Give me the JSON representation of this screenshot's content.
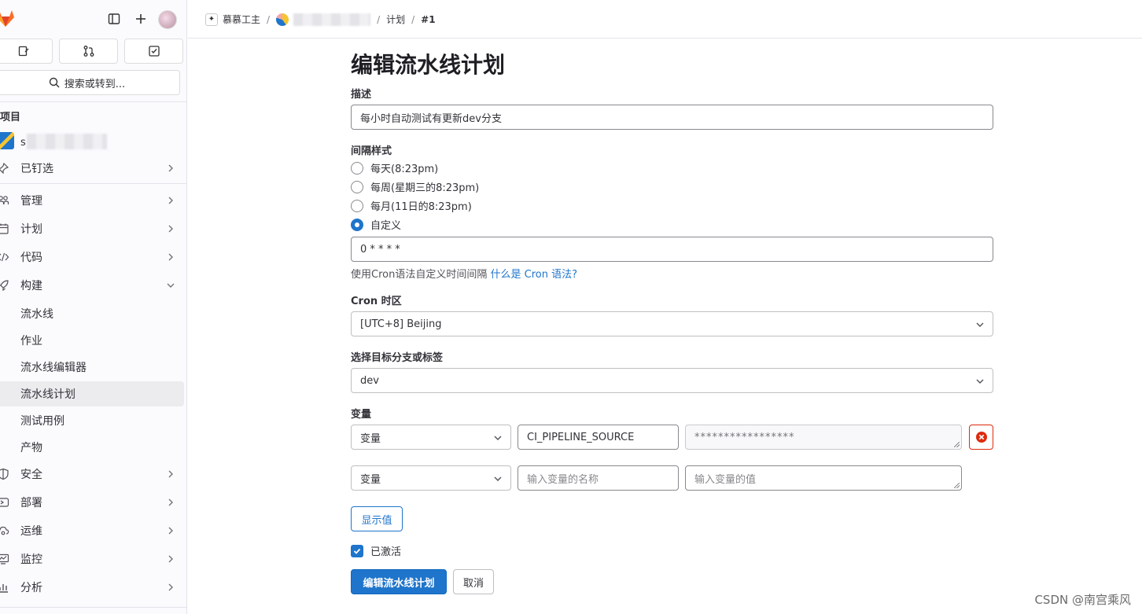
{
  "sidebar": {
    "search_label": "搜索或转到...",
    "section_heading": "项目",
    "project_initial": "s",
    "pinned_label": "已钉选",
    "nav": [
      {
        "label": "管理",
        "icon": "users-icon"
      },
      {
        "label": "计划",
        "icon": "calendar-icon"
      },
      {
        "label": "代码",
        "icon": "code-icon"
      },
      {
        "label": "构建",
        "icon": "rocket-icon"
      },
      {
        "label": "安全",
        "icon": "shield-icon"
      },
      {
        "label": "部署",
        "icon": "deploy-icon"
      },
      {
        "label": "运维",
        "icon": "cloud-gear-icon"
      },
      {
        "label": "监控",
        "icon": "monitor-icon"
      },
      {
        "label": "分析",
        "icon": "chart-icon"
      }
    ],
    "build_sub_items": [
      "流水线",
      "作业",
      "流水线编辑器",
      "流水线计划",
      "测试用例",
      "产物"
    ],
    "active_sub_item": "流水线计划"
  },
  "breadcrumb": {
    "group": "慕慕工主",
    "section": "计划",
    "item": "#1"
  },
  "form": {
    "title": "编辑流水线计划",
    "description_label": "描述",
    "description_value": "每小时自动测试有更新dev分支",
    "interval_label": "间隔样式",
    "interval_options": [
      "每天(8:23pm)",
      "每周(星期三的8:23pm)",
      "每月(11日的8:23pm)",
      "自定义"
    ],
    "interval_selected": "自定义",
    "cron_value": "0 * * * *",
    "cron_help_text": "使用Cron语法自定义时间间隔",
    "cron_help_link": "什么是 Cron 语法?",
    "timezone_label": "Cron 时区",
    "timezone_value": "[UTC+8] Beijing",
    "branch_label": "选择目标分支或标签",
    "branch_value": "dev",
    "variables_label": "变量",
    "variables": [
      {
        "type": "变量",
        "key": "CI_PIPELINE_SOURCE",
        "value": "*****************"
      },
      {
        "type": "变量",
        "key_placeholder": "输入变量的名称",
        "value_placeholder": "输入变量的值"
      }
    ],
    "reveal_button": "显示值",
    "activated_label": "已激活",
    "activated": true,
    "submit_button": "编辑流水线计划",
    "cancel_button": "取消"
  },
  "watermark": "CSDN @南宫乘风",
  "colors": {
    "accent": "#1f75cb",
    "danger": "#dd2b0e",
    "sidebar_bg": "#fbfafd",
    "active_bg": "#ececef"
  }
}
